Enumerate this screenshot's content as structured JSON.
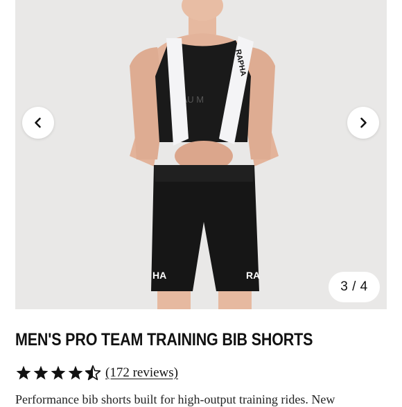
{
  "gallery": {
    "counter": "3 / 4",
    "prev_icon": "chevron-left-icon",
    "next_icon": "chevron-right-icon",
    "background": "#e9e8e7",
    "strap_logo": "RAPHA",
    "leg_logo_left": "HA",
    "leg_logo_right": "RA",
    "mesh_text": "E AU M"
  },
  "product": {
    "title": "MEN'S PRO TEAM TRAINING BIB SHORTS",
    "rating": 4.5,
    "reviews_label": "(172 reviews)",
    "description": "Performance bib shorts built for high-output training rides. New"
  }
}
